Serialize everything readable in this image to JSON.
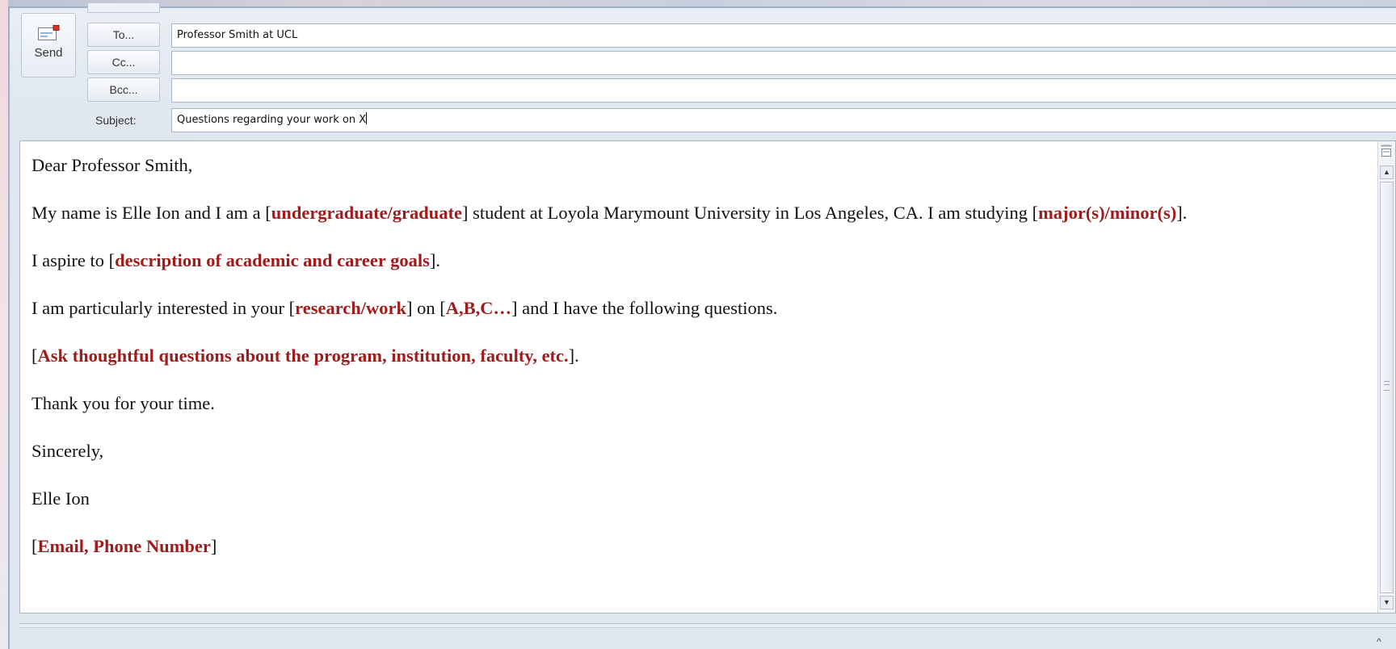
{
  "header": {
    "send_label": "Send",
    "to_button": "To...",
    "cc_button": "Cc...",
    "bcc_button": "Bcc...",
    "subject_label": "Subject:",
    "to_value": "Professor Smith at UCL",
    "cc_value": "",
    "bcc_value": "",
    "subject_value": "Questions regarding your work on X"
  },
  "body": {
    "greeting": "Dear Professor Smith,",
    "p1": {
      "a": "My name is  Elle Ion and I am a [",
      "ph1": "undergraduate/graduate",
      "b": "] student at Loyola Marymount University in Los Angeles, CA. I am studying [",
      "ph2": "major(s)/minor(s)",
      "c": "]."
    },
    "p2": {
      "a": "I aspire to [",
      "ph1": "description of academic and career goals",
      "b": "]."
    },
    "p3": {
      "a": "I am particularly interested in your [",
      "ph1": "research/work",
      "b": "] on [",
      "ph2": "A,B,C…",
      "c": "] and I have the following questions."
    },
    "p4": {
      "a": "[",
      "ph1": "Ask thoughtful questions about the program, institution, faculty, etc.",
      "b": "]."
    },
    "thanks": "Thank you for your time.",
    "closing": "Sincerely,",
    "name": "Elle Ion",
    "p5": {
      "a": "[",
      "ph1": "Email, Phone Number",
      "b": "]"
    }
  },
  "scrollbar": {
    "up_arrow": "▲",
    "down_arrow": "▼",
    "split_icon": "send-icon",
    "bottom_caret": "^"
  },
  "colors": {
    "placeholder": "#a01c1c",
    "window_bg": "#dfe6ef"
  }
}
